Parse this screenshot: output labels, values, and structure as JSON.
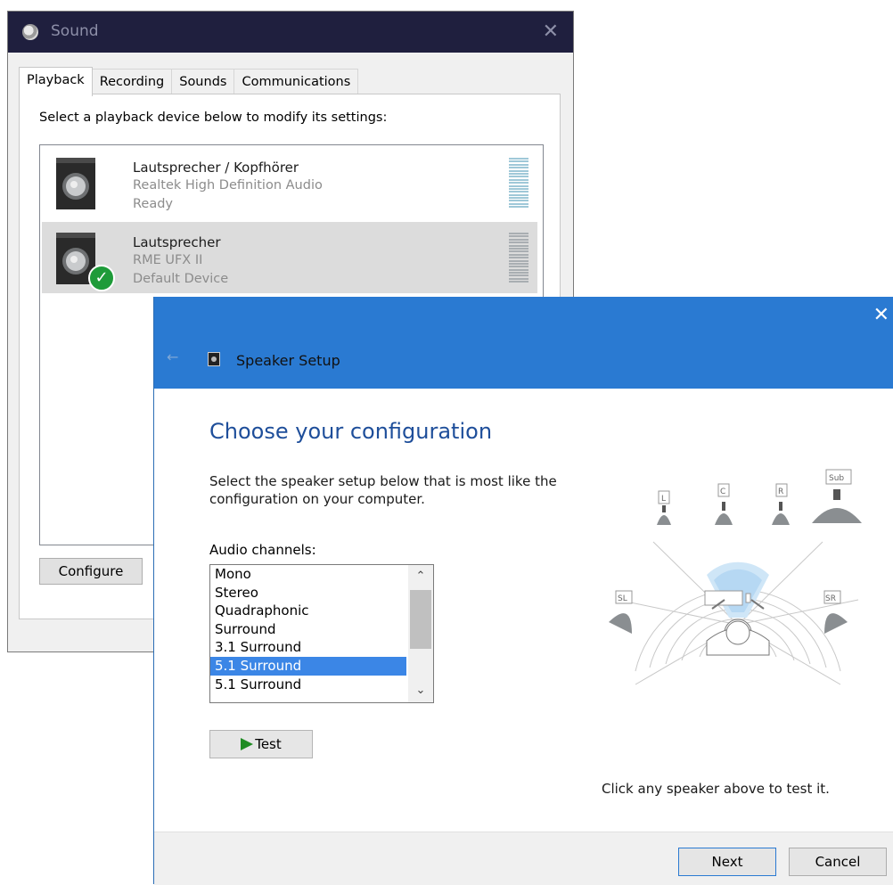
{
  "sound": {
    "title": "Sound",
    "tabs": [
      "Playback",
      "Recording",
      "Sounds",
      "Communications"
    ],
    "instruction": "Select a playback device below to modify its settings:",
    "devices": [
      {
        "name": "Lautsprecher / Kopfhörer",
        "driver": "Realtek High Definition Audio",
        "status": "Ready"
      },
      {
        "name": "Lautsprecher",
        "driver": "RME UFX II",
        "status": "Default Device"
      }
    ],
    "configure_label": "Configure"
  },
  "setup": {
    "window_title": "Speaker Setup",
    "heading": "Choose your configuration",
    "description": "Select the speaker setup below that is most like the configuration on your computer.",
    "channels_label": "Audio channels:",
    "channels": [
      "Mono",
      "Stereo",
      "Quadraphonic",
      "Surround",
      "3.1 Surround",
      "5.1 Surround",
      "5.1 Surround"
    ],
    "selected_channel": "5.1 Surround",
    "test_label": "Test",
    "hint": "Click any speaker above to test it.",
    "speaker_labels": {
      "left": "L",
      "center": "C",
      "right": "R",
      "sub": "Sub",
      "surround_left": "SL",
      "surround_right": "SR"
    },
    "next_label": "Next",
    "cancel_label": "Cancel"
  },
  "colors": {
    "accent": "#2a7ad2",
    "selection": "#3b86e6",
    "sound_titlebar": "#1f1f3e",
    "default_check": "#1e9b39"
  }
}
